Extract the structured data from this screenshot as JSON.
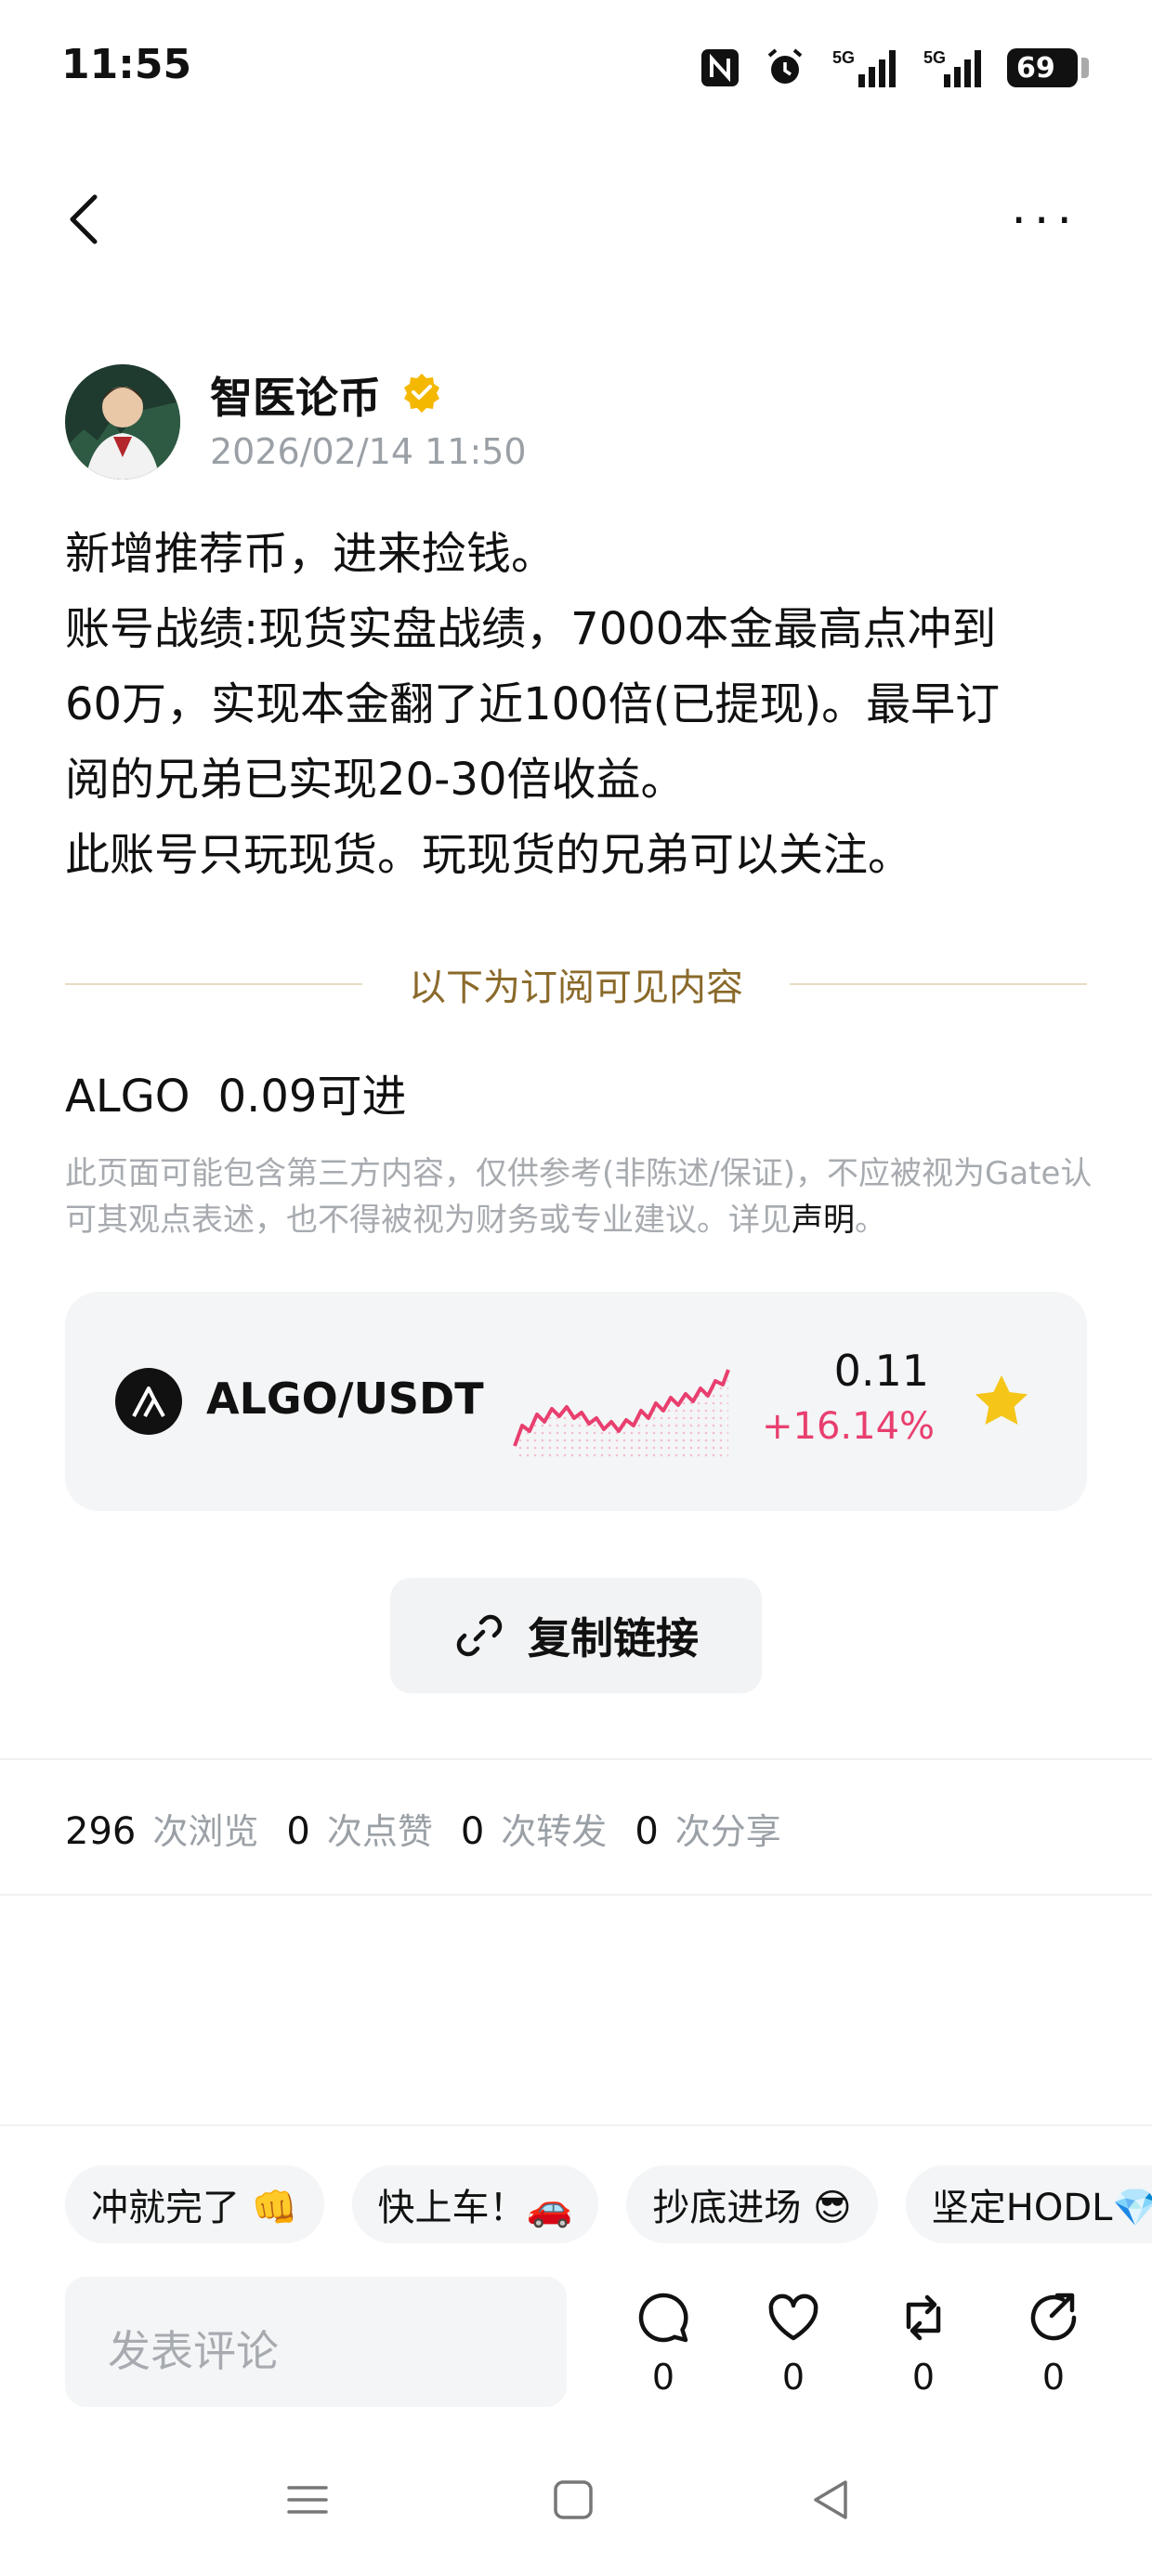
{
  "status_bar": {
    "time": "11:55",
    "signal1": "5G",
    "signal2": "5G",
    "battery": "69"
  },
  "icons": {
    "back": "back-arrow-icon",
    "more": "more-icon",
    "verified": "verified-badge-icon",
    "algo": "algo-logo-icon",
    "star": "star-icon",
    "link": "link-icon",
    "comment": "comment-icon",
    "like": "heart-icon",
    "repost": "repost-icon",
    "share": "share-icon"
  },
  "header": {
    "more_label": "···"
  },
  "post": {
    "author": "智医论币",
    "time": "2026/02/14 11:50",
    "body_lines": [
      "新增推荐币，进来捡钱。",
      "账号战绩:现货实盘战绩，7000本金最高点冲到",
      "60万，实现本金翻了近100倍(已提现)。最早订",
      "阅的兄弟已实现20-30倍收益。",
      "此账号只玩现货。玩现货的兄弟可以关注。"
    ],
    "subscriber_divider": "以下为订阅可见内容",
    "coin_symbol": "ALGO",
    "coin_note": "0.09可进",
    "disclaimer_text": "此页面可能包含第三方内容，仅供参考(非陈述/保证)，不应被视为Gate认可其观点表述，也不得被视为财务或专业建议。详见",
    "disclaimer_link": "声明",
    "disclaimer_end": "。"
  },
  "ticker": {
    "pair": "ALGO/USDT",
    "price": "0.11",
    "change": "+16.14%",
    "trend": "up",
    "accent": "#e83f6f",
    "star_color": "#f5c518"
  },
  "copy_link": {
    "label": "复制链接"
  },
  "stats": [
    {
      "count": "296",
      "label": "次浏览"
    },
    {
      "count": "0",
      "label": "次点赞"
    },
    {
      "count": "0",
      "label": "次转发"
    },
    {
      "count": "0",
      "label": "次分享"
    }
  ],
  "quick_replies": [
    "冲就完了 👊",
    "快上车！🚗",
    "抄底进场 😎",
    "坚定HODL💎"
  ],
  "comment": {
    "placeholder": "发表评论"
  },
  "actions": {
    "comment": "0",
    "like": "0",
    "repost": "0",
    "share": "0"
  }
}
